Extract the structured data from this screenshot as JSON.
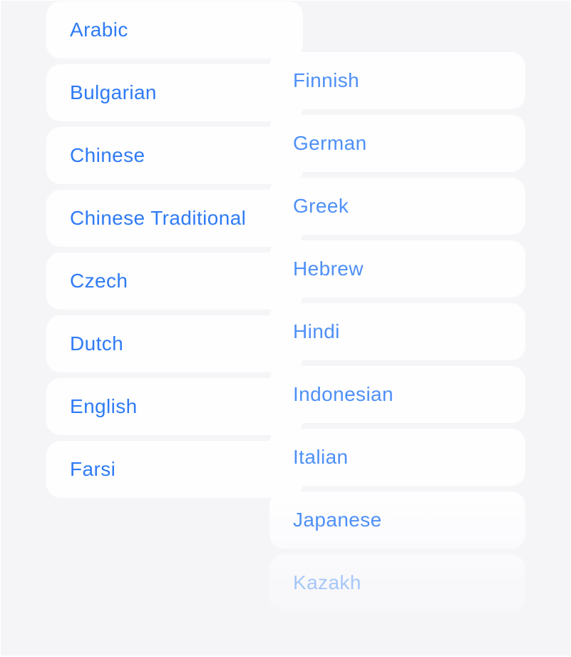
{
  "language_list": {
    "left_column": [
      {
        "label": "Arabic"
      },
      {
        "label": "Bulgarian"
      },
      {
        "label": "Chinese"
      },
      {
        "label": "Chinese Traditional"
      },
      {
        "label": "Czech"
      },
      {
        "label": "Dutch"
      },
      {
        "label": "English"
      },
      {
        "label": "Farsi"
      }
    ],
    "right_column": [
      {
        "label": "Finnish"
      },
      {
        "label": "German"
      },
      {
        "label": "Greek"
      },
      {
        "label": "Hebrew"
      },
      {
        "label": "Hindi"
      },
      {
        "label": "Indonesian"
      },
      {
        "label": "Italian"
      },
      {
        "label": "Japanese"
      },
      {
        "label": "Kazakh"
      }
    ]
  },
  "colors": {
    "background": "#f5f5f7",
    "card": "#fefeff",
    "text_primary": "#2f7bf5",
    "text_secondary": "#4e90f6",
    "text_faded": "#a7c7f9"
  }
}
